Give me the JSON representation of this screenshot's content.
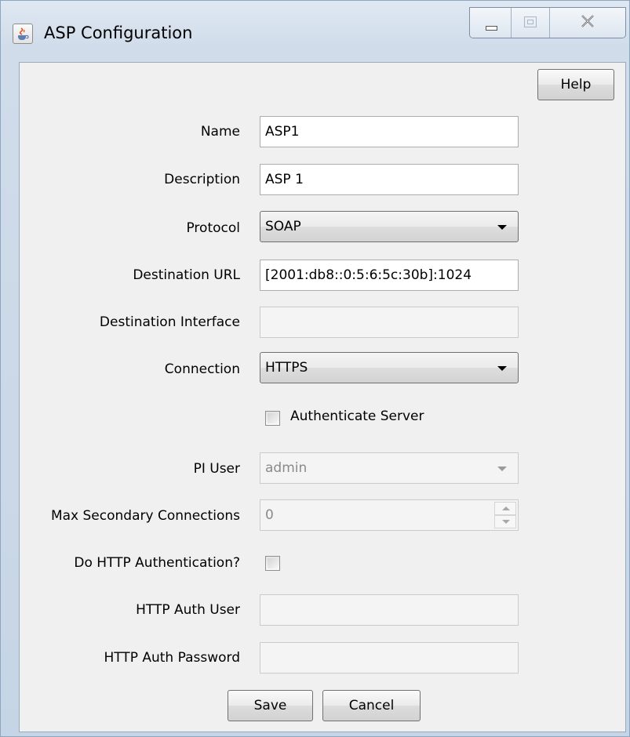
{
  "window": {
    "title": "ASP Configuration"
  },
  "toolbar": {
    "help_label": "Help"
  },
  "form": {
    "name": {
      "label": "Name",
      "value": "ASP1"
    },
    "description": {
      "label": "Description",
      "value": "ASP 1"
    },
    "protocol": {
      "label": "Protocol",
      "value": "SOAP"
    },
    "destination_url": {
      "label": "Destination URL",
      "value": "[2001:db8::0:5:6:5c:30b]:1024"
    },
    "destination_interface": {
      "label": "Destination Interface",
      "value": ""
    },
    "connection": {
      "label": "Connection",
      "value": "HTTPS"
    },
    "authenticate_server": {
      "label": "Authenticate Server",
      "checked": false
    },
    "pi_user": {
      "label": "PI User",
      "value": "admin"
    },
    "max_secondary_connections": {
      "label": "Max Secondary Connections",
      "value": "0"
    },
    "do_http_auth": {
      "label": "Do HTTP Authentication?",
      "checked": false
    },
    "http_auth_user": {
      "label": "HTTP Auth User",
      "value": ""
    },
    "http_auth_password": {
      "label": "HTTP Auth Password",
      "value": ""
    }
  },
  "actions": {
    "save_label": "Save",
    "cancel_label": "Cancel"
  },
  "icons": {
    "app": "java-cup-icon",
    "minimize": "minimize-icon",
    "maximize": "maximize-icon",
    "close": "close-icon"
  }
}
